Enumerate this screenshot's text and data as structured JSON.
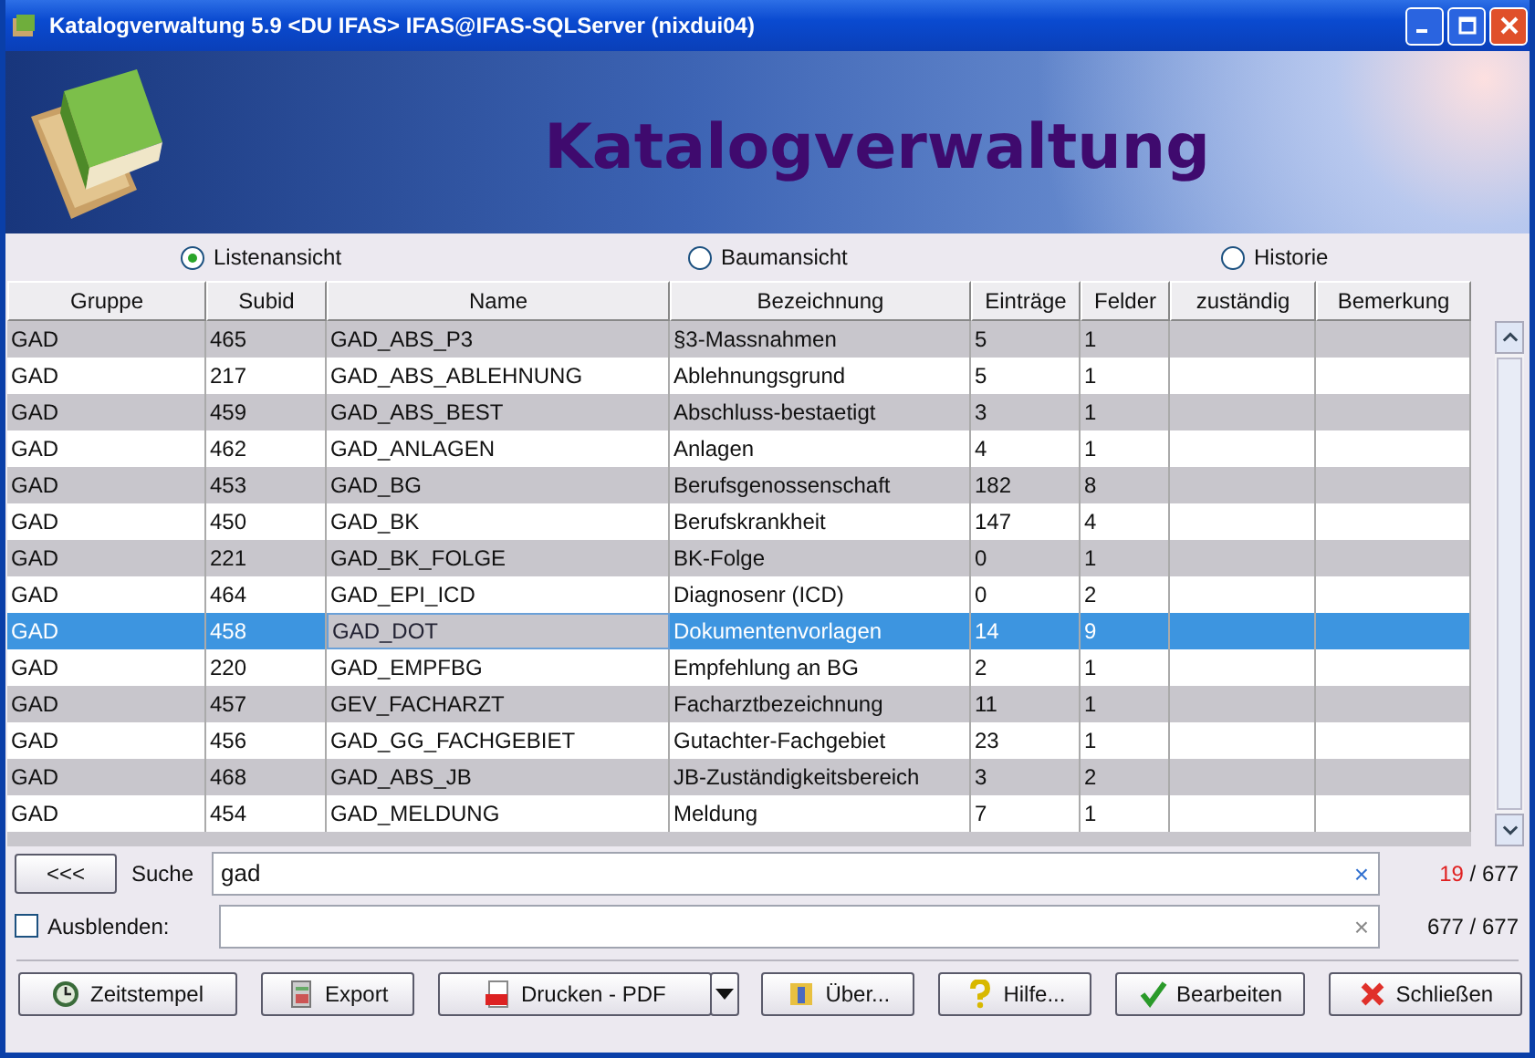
{
  "window": {
    "title": "Katalogverwaltung 5.9  <DU IFAS> IFAS@IFAS-SQLServer (nixdui04)"
  },
  "banner": {
    "title": "Katalogverwaltung"
  },
  "views": [
    {
      "label": "Listenansicht",
      "selected": true
    },
    {
      "label": "Baumansicht",
      "selected": false
    },
    {
      "label": "Historie",
      "selected": false
    }
  ],
  "table": {
    "columns": [
      "Gruppe",
      "Subid",
      "Name",
      "Bezeichnung",
      "Einträge",
      "Felder",
      "zuständig",
      "Bemerkung"
    ],
    "rows": [
      {
        "cells": [
          "GAD",
          "465",
          "GAD_ABS_P3",
          "§3-Massnahmen",
          "5",
          "1",
          "",
          ""
        ],
        "selected": false
      },
      {
        "cells": [
          "GAD",
          "217",
          "GAD_ABS_ABLEHNUNG",
          "Ablehnungsgrund",
          "5",
          "1",
          "",
          ""
        ],
        "selected": false
      },
      {
        "cells": [
          "GAD",
          "459",
          "GAD_ABS_BEST",
          "Abschluss-bestaetigt",
          "3",
          "1",
          "",
          ""
        ],
        "selected": false
      },
      {
        "cells": [
          "GAD",
          "462",
          "GAD_ANLAGEN",
          "Anlagen",
          "4",
          "1",
          "",
          ""
        ],
        "selected": false
      },
      {
        "cells": [
          "GAD",
          "453",
          "GAD_BG",
          "Berufsgenossenschaft",
          "182",
          "8",
          "",
          ""
        ],
        "selected": false
      },
      {
        "cells": [
          "GAD",
          "450",
          "GAD_BK",
          "Berufskrankheit",
          "147",
          "4",
          "",
          ""
        ],
        "selected": false
      },
      {
        "cells": [
          "GAD",
          "221",
          "GAD_BK_FOLGE",
          "BK-Folge",
          "0",
          "1",
          "",
          ""
        ],
        "selected": false
      },
      {
        "cells": [
          "GAD",
          "464",
          "GAD_EPI_ICD",
          "Diagnosenr (ICD)",
          "0",
          "2",
          "",
          ""
        ],
        "selected": false
      },
      {
        "cells": [
          "GAD",
          "458",
          "GAD_DOT",
          "Dokumentenvorlagen",
          "14",
          "9",
          "",
          ""
        ],
        "selected": true
      },
      {
        "cells": [
          "GAD",
          "220",
          "GAD_EMPFBG",
          "Empfehlung an BG",
          "2",
          "1",
          "",
          ""
        ],
        "selected": false
      },
      {
        "cells": [
          "GAD",
          "457",
          "GEV_FACHARZT",
          "Facharztbezeichnung",
          "11",
          "1",
          "",
          ""
        ],
        "selected": false
      },
      {
        "cells": [
          "GAD",
          "456",
          "GAD_GG_FACHGEBIET",
          "Gutachter-Fachgebiet",
          "23",
          "1",
          "",
          ""
        ],
        "selected": false
      },
      {
        "cells": [
          "GAD",
          "468",
          "GAD_ABS_JB",
          "JB-Zuständigkeitsbereich",
          "3",
          "2",
          "",
          ""
        ],
        "selected": false
      },
      {
        "cells": [
          "GAD",
          "454",
          "GAD_MELDUNG",
          "Meldung",
          "7",
          "1",
          "",
          ""
        ],
        "selected": false
      }
    ]
  },
  "search": {
    "back_button": "<<<",
    "label": "Suche",
    "value": "gad",
    "clear": "×",
    "hits": "19",
    "of": "/ 677",
    "hits_alert": true
  },
  "filter": {
    "label": "Ausblenden:",
    "checked": false,
    "clear": "×",
    "hits": "677",
    "of": "/ 677",
    "hits_alert": false
  },
  "buttons": [
    {
      "label": "Zeitstempel",
      "kind": "clock"
    },
    {
      "label": "Export",
      "kind": "export"
    },
    {
      "label": "Drucken - PDF",
      "kind": "pdf",
      "dropdown": true
    },
    {
      "label": "Über...",
      "kind": "info"
    },
    {
      "label": "Hilfe...",
      "kind": "help"
    },
    {
      "label": "Bearbeiten",
      "kind": "check"
    },
    {
      "label": "Schließen",
      "kind": "close"
    }
  ]
}
